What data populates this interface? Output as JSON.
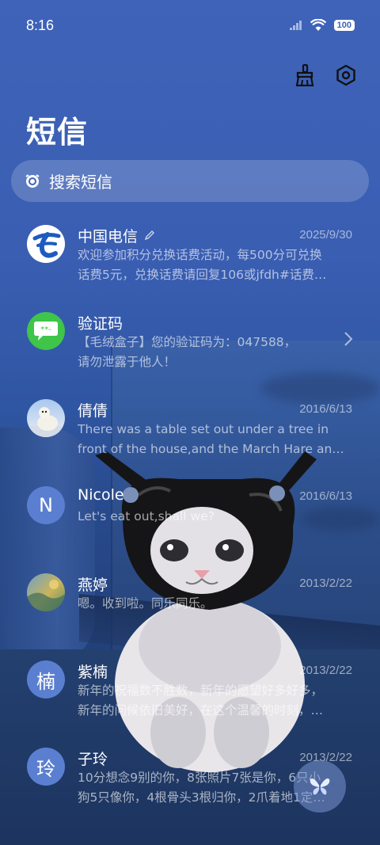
{
  "status": {
    "time": "8:16",
    "battery": "100"
  },
  "header": {
    "title": "短信"
  },
  "search": {
    "placeholder": "搜索短信"
  },
  "conversations": [
    {
      "name": "中国电信",
      "date": "2025/9/30",
      "lines": [
        "欢迎参加积分兑换话费活动，每500分可兑换",
        "话费5元，兑换话费请回复106或jfdh#话费…"
      ],
      "avatar": "china-telecom-logo"
    },
    {
      "name": "验证码",
      "date": "",
      "lines": [
        "【毛绒盒子】您的验证码为：047588，",
        "请勿泄露于他人！"
      ],
      "avatar": "message-bubble"
    },
    {
      "name": "倩倩",
      "date": "2016/6/13",
      "lines": [
        "There was a table set out under a tree in",
        "front of the house,and the March Hare an…"
      ],
      "avatar": "polar-bear-photo"
    },
    {
      "name": "Nicole",
      "date": "2016/6/13",
      "lines": [
        "Let's eat out,shall we?"
      ],
      "avatar_letter": "N"
    },
    {
      "name": "燕婷",
      "date": "2013/2/22",
      "lines": [
        "嗯。收到啦。同乐同乐。"
      ],
      "avatar": "landscape-photo"
    },
    {
      "name": "紫楠",
      "date": "2013/2/22",
      "lines": [
        "新年的祝福数不胜数，新年的愿望好多好多，",
        "新年的问候依旧美好，在这个温馨的时刻，…"
      ],
      "avatar_letter": "楠"
    },
    {
      "name": "子玲",
      "date": "2013/2/22",
      "lines": [
        "10分想念9别的你，8张照片7张是你，6只小",
        "狗5只像你，4根骨头3根归你，2爪着地1定…"
      ],
      "avatar_letter": "玲"
    }
  ],
  "colors": {
    "accent": "#3e63b8",
    "wechat_green": "#3ec54a",
    "telecom_blue": "#1e5bbf"
  }
}
